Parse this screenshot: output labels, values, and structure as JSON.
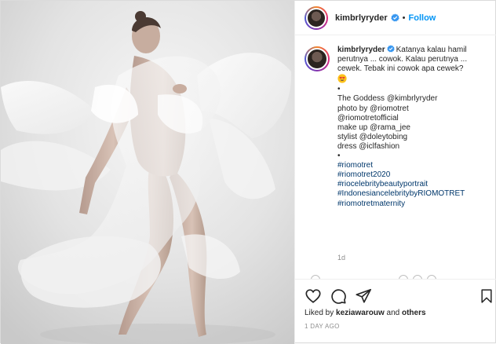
{
  "post": {
    "author": "kimbrlyryder",
    "follow_label": "Follow",
    "dot": "•",
    "caption_lines": [
      {
        "text": "Katanya kalau hamil",
        "kind": "plain"
      },
      {
        "text": "perutnya ... cowok. Kalau perutnya ...",
        "kind": "plain"
      },
      {
        "text": "cewek. Tebak ini cowok apa cewek?",
        "kind": "plain"
      },
      {
        "text": "•",
        "kind": "plain"
      },
      {
        "text": "The Goddess @kimbrlyryder",
        "kind": "plain"
      },
      {
        "text": "photo by @riomotret",
        "kind": "plain"
      },
      {
        "text": "@riomotretofficial",
        "kind": "plain"
      },
      {
        "text": "make up @rama_jee",
        "kind": "plain"
      },
      {
        "text": "stylist @doleytobing",
        "kind": "plain"
      },
      {
        "text": "dress @iclfashion",
        "kind": "plain"
      },
      {
        "text": "•",
        "kind": "plain"
      },
      {
        "text": "#riomotret",
        "kind": "tag"
      },
      {
        "text": "#riomotret2020",
        "kind": "tag"
      },
      {
        "text": "#riocelebritybeautyportrait",
        "kind": "tag"
      },
      {
        "text": "#IndonesiancelebritybyRIOMOTRET",
        "kind": "tag"
      },
      {
        "text": "#riomotretmaternity",
        "kind": "tag"
      }
    ],
    "emoji": "smiling-face-with-heart-eyes",
    "time_ago": "1d",
    "liked_prefix": "Liked by ",
    "liked_user": "keziawarouw",
    "liked_suffix": " and ",
    "liked_others": "others",
    "date": "1 DAY AGO"
  },
  "colors": {
    "link": "#00376b",
    "follow": "#0095f6",
    "verified": "#3897f0",
    "muted": "#8e8e8e"
  },
  "icons": [
    "heart-icon",
    "comment-icon",
    "share-icon",
    "bookmark-icon",
    "verified-badge-icon"
  ]
}
